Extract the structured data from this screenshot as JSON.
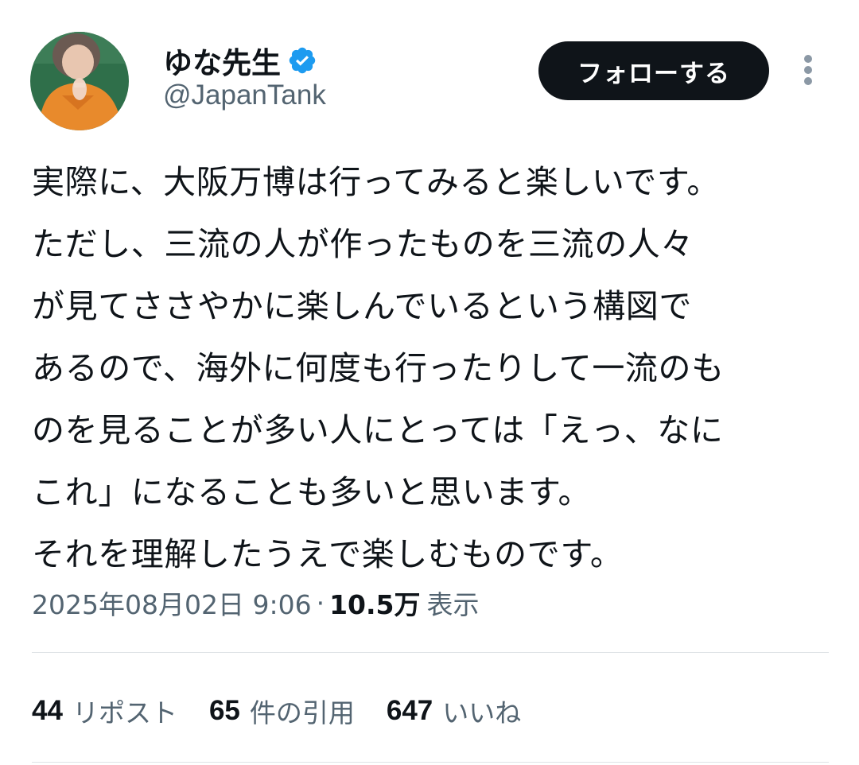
{
  "author": {
    "display_name": "ゆな先生",
    "handle": "@JapanTank",
    "verified": true
  },
  "follow_button_label": "フォローする",
  "tweet": {
    "lines": [
      "実際に、大阪万博は行ってみると楽しいです。",
      "ただし、三流の人が作ったものを三流の人々",
      "が見てささやかに楽しんでいるという構図で",
      "あるので、海外に何度も行ったりして一流のも",
      "のを見ることが多い人にとっては「えっ、なに",
      "これ」になることも多いと思います。",
      "それを理解したうえで楽しむものです。"
    ]
  },
  "meta": {
    "timestamp": "2025年08月02日 9:06",
    "separator": "·",
    "views_count": "10.5万",
    "views_label": "表示"
  },
  "stats": {
    "reposts_count": "44",
    "reposts_label": "リポスト",
    "quotes_count": "65",
    "quotes_label": "件の引用",
    "likes_count": "647",
    "likes_label": "いいね"
  },
  "colors": {
    "text_primary": "#0f1419",
    "text_secondary": "#536471",
    "verified_blue": "#1d9bf0",
    "divider": "#dfe3e6",
    "button_bg": "#0f1419",
    "button_text": "#ffffff"
  },
  "icons": {
    "verified": "verified-badge-icon",
    "more": "more-vertical-icon"
  }
}
